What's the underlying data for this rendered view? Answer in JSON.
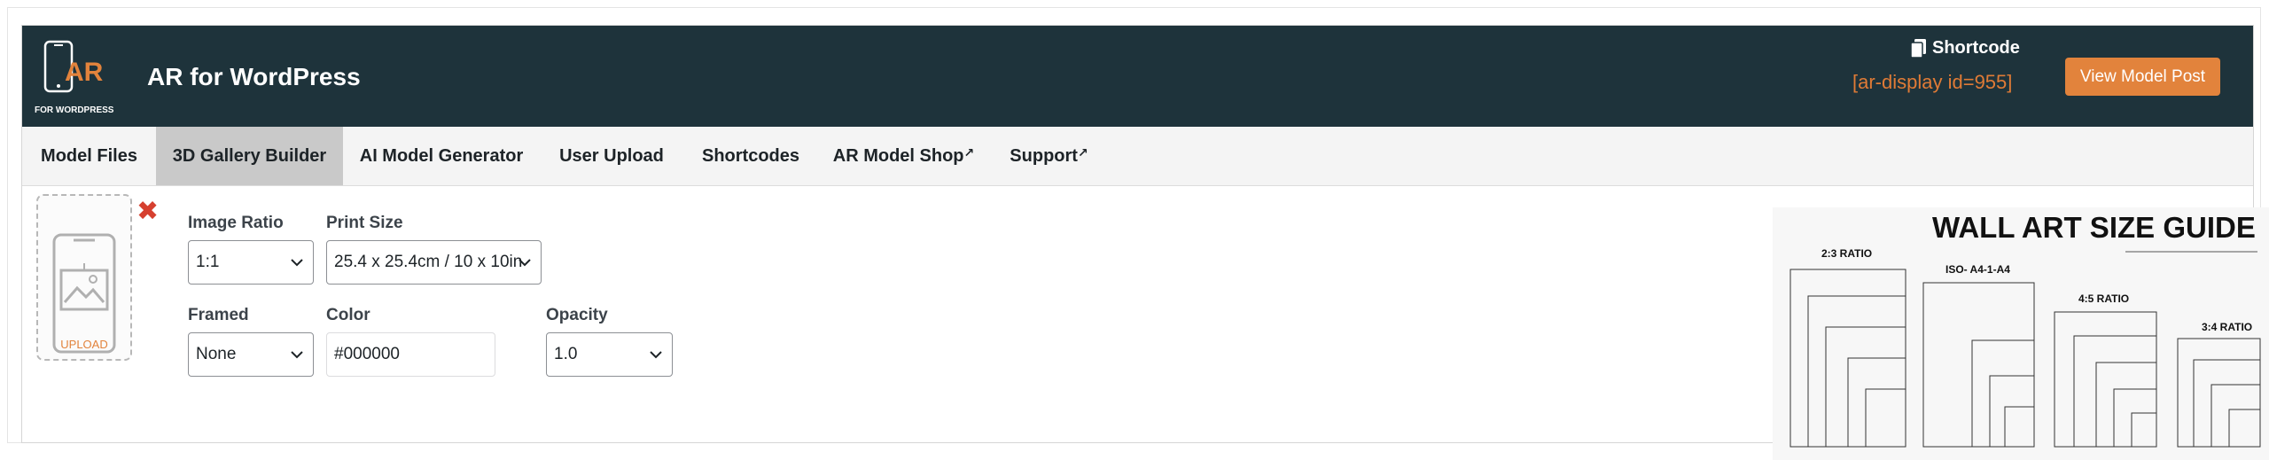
{
  "header": {
    "logo_text": "AR",
    "logo_subtext": "FOR WORDPRESS",
    "title": "AR for WordPress",
    "shortcode_label": "Shortcode",
    "shortcode_value": "[ar-display id=955]",
    "view_button": "View Model Post"
  },
  "tabs": [
    {
      "label": "Model Files",
      "active": false
    },
    {
      "label": "3D Gallery Builder",
      "active": true
    },
    {
      "label": "AI Model Generator",
      "active": false
    },
    {
      "label": "User Upload",
      "active": false
    },
    {
      "label": "Shortcodes",
      "active": false
    },
    {
      "label": "AR Model Shop",
      "active": false,
      "external": true
    },
    {
      "label": "Support",
      "active": false,
      "external": true
    }
  ],
  "upload": {
    "label": "UPLOAD"
  },
  "form": {
    "image_ratio": {
      "label": "Image Ratio",
      "value": "1:1"
    },
    "print_size": {
      "label": "Print Size",
      "value": "25.4 x 25.4cm / 10 x 10in"
    },
    "framed": {
      "label": "Framed",
      "value": "None"
    },
    "color": {
      "label": "Color",
      "value": "#000000"
    },
    "opacity": {
      "label": "Opacity",
      "value": "1.0"
    }
  },
  "size_guide": {
    "title": "WALL ART SIZE GUIDE",
    "sections": [
      "2:3 RATIO",
      "ISO- A4-1-A4",
      "4:5 RATIO",
      "3:4 RATIO"
    ]
  },
  "colors": {
    "header_bg": "#1e333b",
    "accent": "#e2833c",
    "shortcode_text": "#e07b36",
    "active_tab": "#c9c9c9"
  }
}
